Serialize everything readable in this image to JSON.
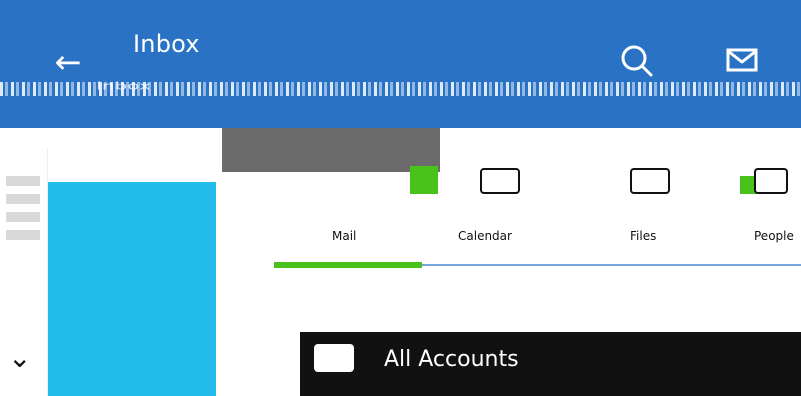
{
  "appbar": {
    "title": "Inbox",
    "back_icon": "arrow-left-icon",
    "search_icon": "search-icon",
    "mail_icon": "mail-icon",
    "ghost_title": "Inbox"
  },
  "tabs": [
    {
      "label": "Mail"
    },
    {
      "label": "Calendar"
    },
    {
      "label": "Files"
    },
    {
      "label": "People"
    }
  ],
  "accounts": {
    "label": "All Accounts",
    "icon": "mail-icon"
  },
  "colors": {
    "appbar": "#2a73c4",
    "accent_green": "#49c21c",
    "accent_cyan": "#24bdeb"
  }
}
